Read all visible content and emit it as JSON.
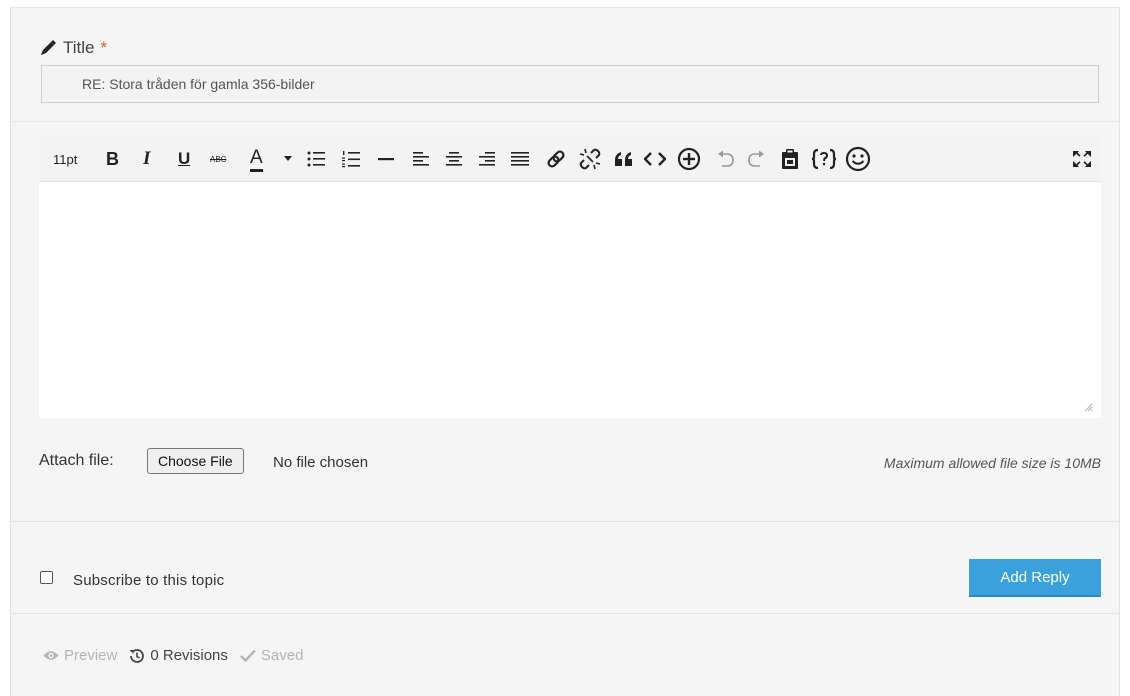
{
  "form": {
    "title_label": "Title",
    "required_mark": "*",
    "title_value": "RE: Stora tråden för gamla 356-bilder"
  },
  "toolbar": {
    "font_size": "11pt",
    "bold": "B",
    "italic": "I",
    "underline": "U",
    "strikethrough": "ABC",
    "font_color": "A",
    "icons": [
      "bold-icon",
      "italic-icon",
      "underline-icon",
      "strikethrough-icon",
      "font-color-icon",
      "bullet-list-icon",
      "numbered-list-icon",
      "horizontal-rule-icon",
      "align-left-icon",
      "align-center-icon",
      "align-right-icon",
      "align-justify-icon",
      "link-icon",
      "unlink-icon",
      "blockquote-icon",
      "code-icon",
      "insert-icon",
      "undo-icon",
      "redo-icon",
      "paste-icon",
      "code-block-icon",
      "emoji-icon",
      "fullscreen-icon"
    ]
  },
  "attach": {
    "label": "Attach file:",
    "button": "Choose File",
    "status": "No file chosen",
    "max_size": "Maximum allowed file size is 10MB"
  },
  "subscribe": {
    "label": "Subscribe to this topic",
    "checked": false
  },
  "submit": {
    "label": "Add Reply"
  },
  "footer": {
    "preview": "Preview",
    "revisions": "0 Revisions",
    "saved": "Saved"
  },
  "colors": {
    "accent": "#3aa1dd",
    "required": "#e8541c",
    "panel_bg": "#f5f5f5"
  }
}
